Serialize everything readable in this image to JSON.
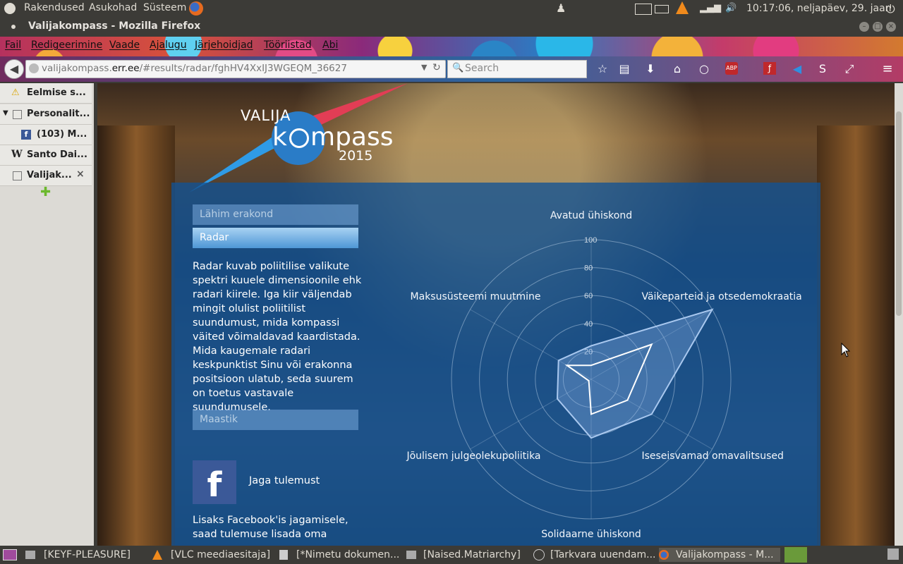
{
  "top_panel": {
    "menus": [
      "Rakendused",
      "Asukohad",
      "Süsteem"
    ],
    "clock": "10:17:06, neljapäev, 29. jaan"
  },
  "window": {
    "title": "Valijakompass - Mozilla Firefox"
  },
  "menubar": [
    "Fail",
    "Redigeerimine",
    "Vaade",
    "Ajalugu",
    "Järjehoidjad",
    "Tööriistad",
    "Abi"
  ],
  "navbar": {
    "url_prefix": "valijakompass.",
    "url_domain": "err.ee",
    "url_rest": "/#results/radar/fghHV4XxIJ3WGEQM_36627",
    "search_placeholder": "Search"
  },
  "tabs": [
    {
      "label": "Eelmise s...",
      "icon": "warning-icon"
    },
    {
      "label": "Personalit...",
      "icon": "page-icon"
    },
    {
      "label": "(103) M...",
      "icon": "facebook-icon"
    },
    {
      "label": "Santo Dai...",
      "icon": "wikipedia-icon"
    },
    {
      "label": "Valijak...",
      "icon": "page-icon"
    }
  ],
  "logo": {
    "line1": "VALIJA",
    "line2a": "k",
    "line2b": "mpass",
    "year": "2015"
  },
  "sidebar": {
    "btn_nearest": "Lähim erakond",
    "btn_radar": "Radar",
    "description": "Radar kuvab poliitilise valikute spektri kuuele dimensioonile ehk radari kiirele. Iga kiir väljendab mingit olulist poliitilist suundumust, mida kompassi väited võimaldavad kaardistada. Mida kaugemale radari keskpunktist Sinu või erakonna positsioon ulatub, seda suurem on toetus vastavale suundumusele.",
    "btn_terrain": "Maastik",
    "share_label": "Jaga tulemust",
    "share_text": "Lisaks Facebook'is jagamisele, saad tulemuse lisada oma"
  },
  "chart_data": {
    "type": "radar",
    "axes": [
      "Avatud ühiskond",
      "Väikeparteid ja otsedemokraatia",
      "Iseseisvamad omavalitsused",
      "Solidaarne ühiskond",
      "Jõulisem julgeolekupoliitika",
      "Maksusüsteemi muutmine"
    ],
    "ticks": [
      "20",
      "40",
      "60",
      "80",
      "100"
    ],
    "range": [
      0,
      100
    ],
    "series": [
      {
        "values": [
          24,
          100,
          50,
          42,
          28,
          27
        ],
        "color": "#a9c8ef",
        "fill": "rgba(140,180,235,0.35)"
      },
      {
        "values": [
          10,
          50,
          30,
          25,
          2,
          20
        ],
        "color": "#ffffff",
        "fill": "none"
      }
    ]
  },
  "taskbar": [
    "[KEYF-PLEASURE]",
    "[VLC meediaesitaja]",
    "[*Nimetu dokumen...",
    "[Naised.Matriarchy]",
    "[Tarkvara uuendam...",
    "Valijakompass - M..."
  ]
}
